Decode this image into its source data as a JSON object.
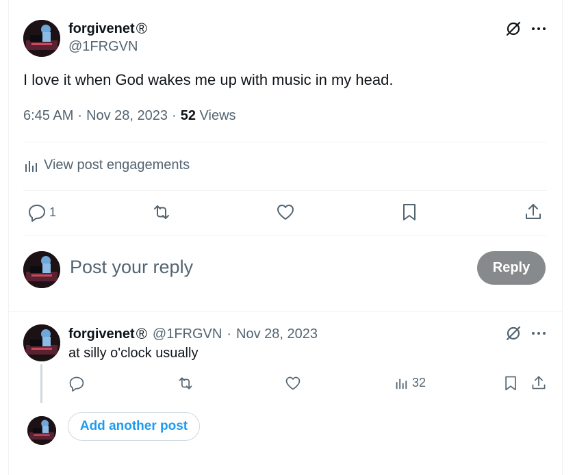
{
  "post": {
    "display_name": "forgivenet",
    "registered_mark": "®",
    "handle": "@1FRGVN",
    "text": "I love it when God wakes me up with music in my head.",
    "time": "6:45 AM",
    "date": "Nov 28, 2023",
    "views_count": "52",
    "views_label": "Views",
    "separator": "·",
    "engagements_label": "View post engagements",
    "reply_count": "1"
  },
  "composer": {
    "placeholder": "Post your reply",
    "reply_button": "Reply"
  },
  "reply": {
    "display_name": "forgivenet",
    "registered_mark": "®",
    "handle": "@1FRGVN",
    "separator": "·",
    "date": "Nov 28, 2023",
    "text": "at silly o'clock usually",
    "views_count": "32"
  },
  "thread": {
    "add_another_label": "Add another post"
  },
  "icons": {
    "grok": "grok-icon",
    "more": "more-icon",
    "reply": "reply-icon",
    "repost": "repost-icon",
    "like": "heart-icon",
    "bookmark": "bookmark-icon",
    "share": "share-icon",
    "analytics": "analytics-icon"
  },
  "colors": {
    "text": "#0f1419",
    "secondary": "#536471",
    "accent": "#1d9bf0",
    "disabled_button": "#878a8c",
    "border": "#eff3f4"
  }
}
